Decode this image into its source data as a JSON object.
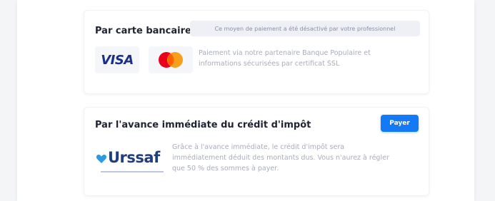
{
  "card_payment": {
    "title": "Par carte bancaire",
    "notice": "Ce moyen de paiement a été désactivé par votre professionnel",
    "logos": {
      "visa": "VISA",
      "mastercard_icon": "mastercard-icon"
    },
    "description": "Paiement via notre partenaire Banque Populaire et informations sécurisées par certificat SSL"
  },
  "tax_credit": {
    "title": "Par l'avance immédiate du crédit d'impôt",
    "pay_button": "Payer",
    "urssaf_logo_text": "Urssaf",
    "description": "Grâce à l'avance immédiate, le crédit d'impôt sera immédiatement déduit des montants dus. Vous n'aurez à régler que 50 % des sommes à payer."
  },
  "colors": {
    "accent": "#1479f5",
    "urssaf": "#1f3f80",
    "visa": "#1a2e8c"
  }
}
